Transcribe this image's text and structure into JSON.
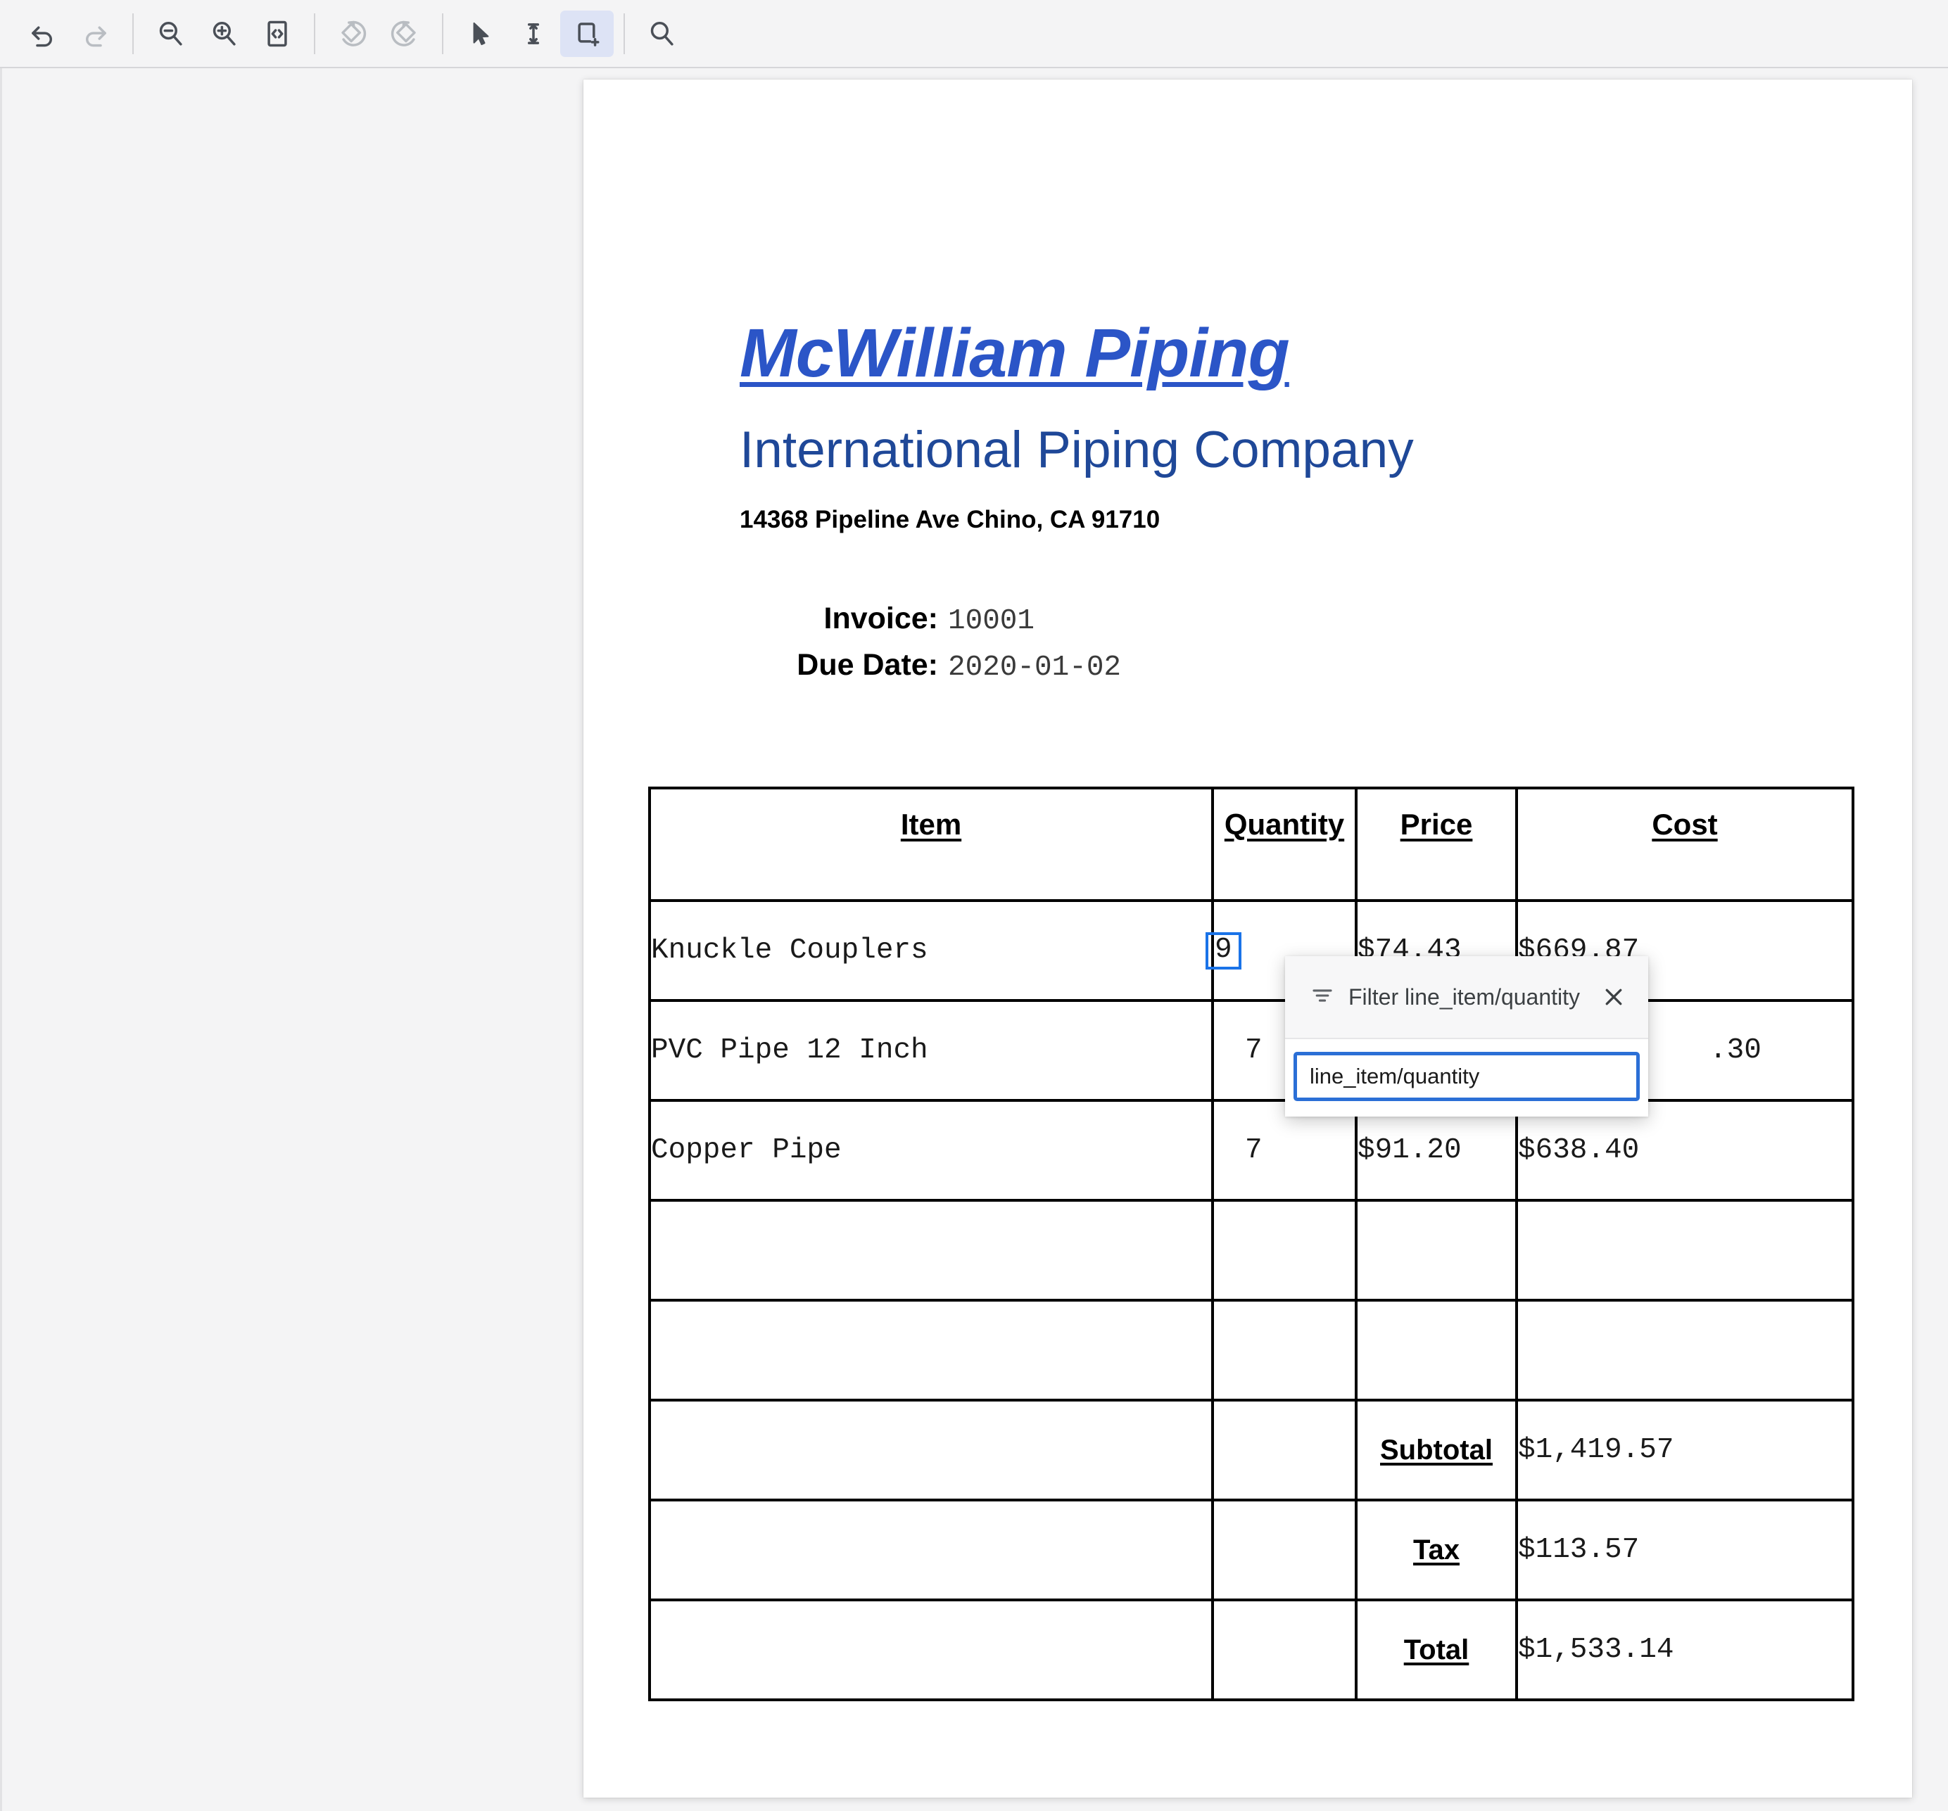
{
  "toolbar": {
    "groups": [
      {
        "name": "history",
        "buttons": [
          {
            "icon": "undo-icon",
            "label": "Undo",
            "state": "enabled"
          },
          {
            "icon": "redo-icon",
            "label": "Redo",
            "state": "disabled"
          }
        ]
      },
      {
        "name": "zoom",
        "buttons": [
          {
            "icon": "zoom-out-icon",
            "label": "Zoom out",
            "state": "enabled"
          },
          {
            "icon": "zoom-in-icon",
            "label": "Zoom in",
            "state": "enabled"
          },
          {
            "icon": "fit-width-icon",
            "label": "Fit to width",
            "state": "enabled"
          }
        ]
      },
      {
        "name": "rotate",
        "buttons": [
          {
            "icon": "rotate-left-icon",
            "label": "Rotate left",
            "state": "disabled"
          },
          {
            "icon": "rotate-right-icon",
            "label": "Rotate right",
            "state": "disabled"
          }
        ]
      },
      {
        "name": "tools",
        "buttons": [
          {
            "icon": "select-pointer-icon",
            "label": "Select",
            "state": "enabled"
          },
          {
            "icon": "text-cursor-icon",
            "label": "Text select",
            "state": "enabled"
          },
          {
            "icon": "add-region-icon",
            "label": "Add region",
            "state": "active"
          }
        ]
      },
      {
        "name": "find",
        "buttons": [
          {
            "icon": "search-icon",
            "label": "Search",
            "state": "enabled"
          }
        ]
      }
    ]
  },
  "document": {
    "brand_title": "McWilliam Piping",
    "brand_subtitle": "International Piping Company",
    "address": "14368 Pipeline Ave Chino, CA 91710",
    "meta": [
      {
        "label": "Invoice:",
        "value": "10001"
      },
      {
        "label": "Due Date:",
        "value": "2020-01-02"
      }
    ],
    "table": {
      "headers": [
        "Item",
        "Quantity",
        "Price",
        "Cost"
      ],
      "rows": [
        {
          "item": "Knuckle Couplers",
          "quantity": "9",
          "price": "$74.43",
          "cost": "$669.87",
          "quantity_selected": true
        },
        {
          "item": "PVC Pipe 12 Inch",
          "quantity": "7",
          "price": "",
          "cost": ".30",
          "quantity_selected": false
        },
        {
          "item": "Copper Pipe",
          "quantity": "7",
          "price": "$91.20",
          "cost": "$638.40",
          "quantity_selected": false
        },
        {
          "item": "",
          "quantity": "",
          "price": "",
          "cost": "",
          "quantity_selected": false
        },
        {
          "item": "",
          "quantity": "",
          "price": "",
          "cost": "",
          "quantity_selected": false
        }
      ],
      "totals": [
        {
          "label": "Subtotal",
          "value": "$1,419.57"
        },
        {
          "label": "Tax",
          "value": "$113.57"
        },
        {
          "label": "Total",
          "value": "$1,533.14"
        }
      ]
    }
  },
  "filter_popup": {
    "title": "Filter line_item/quantity",
    "close_label": "×",
    "input_value": "line_item/quantity",
    "input_placeholder": "line_item/quantity"
  },
  "colors": {
    "brand_blue": "#2b55c7",
    "subtitle_blue": "#1f4898",
    "selection_blue": "#1a73e8",
    "popup_accent": "#2b6fd6",
    "toolbar_bg": "#f4f4f5",
    "active_tool_bg": "#dde3f5"
  }
}
